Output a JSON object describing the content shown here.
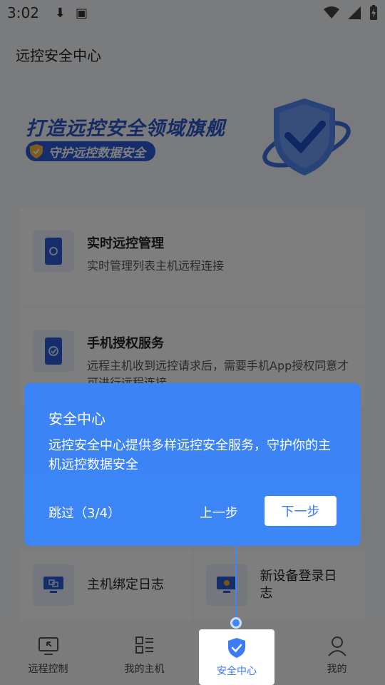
{
  "status_bar": {
    "time": "3:02"
  },
  "header": {
    "title": "远控安全中心"
  },
  "banner": {
    "slogan": "打造远控安全领域旗舰",
    "tagline": "守护远控数据安全"
  },
  "features": [
    {
      "title": "实时远控管理",
      "desc": "实时管理列表主机远程连接"
    },
    {
      "title": "手机授权服务",
      "desc": "远程主机收到远控请求后，需要手机App授权同意才可进行远程连接"
    }
  ],
  "logs": [
    {
      "label": "主机绑定日志"
    },
    {
      "label": "新设备登录日志"
    }
  ],
  "guide": {
    "title": "安全中心",
    "body": "远控安全中心提供多样远控安全服务，守护你的主机远控数据安全",
    "skip": "跳过（3/4）",
    "prev": "上一步",
    "next": "下一步"
  },
  "nav": {
    "items": [
      {
        "label": "远程控制",
        "icon": "remote-control-icon"
      },
      {
        "label": "我的主机",
        "icon": "host-list-icon"
      },
      {
        "label": "安全中心",
        "icon": "shield-check-icon",
        "active": true
      },
      {
        "label": "我的",
        "icon": "profile-icon"
      }
    ]
  },
  "colors": {
    "accent": "#3a7bf6",
    "guide_bg": "#3d86f7",
    "brand_dark": "#2c56c8"
  }
}
